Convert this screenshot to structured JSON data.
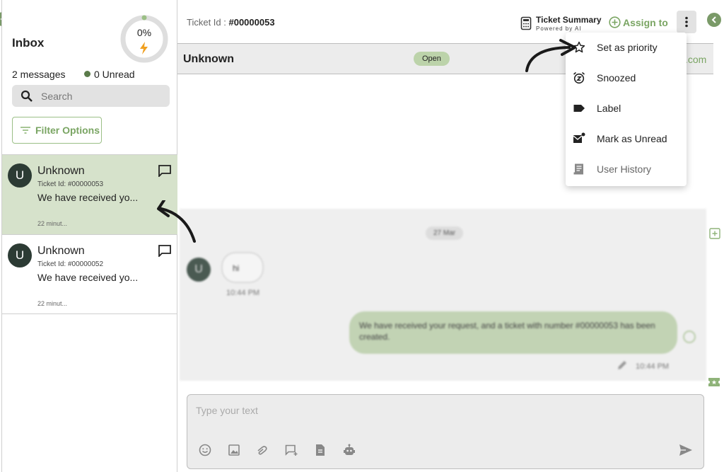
{
  "sidebar": {
    "title": "Inbox",
    "progress_text": "0%",
    "progress_value": 0,
    "message_count": "2 messages",
    "unread": "0 Unread",
    "search_placeholder": "Search",
    "filter_label": "Filter Options",
    "conversations": [
      {
        "initial": "U",
        "name": "Unknown",
        "ticket": "Ticket Id: #00000053",
        "preview": "We have received yo...",
        "time": "22 minut..."
      },
      {
        "initial": "U",
        "name": "Unknown",
        "ticket": "Ticket Id: #00000052",
        "preview": "We have received yo...",
        "time": "22 minut..."
      }
    ]
  },
  "header": {
    "ticket_label": "Ticket Id : ",
    "ticket_value": "#00000053",
    "summary_title": "Ticket Summary",
    "summary_sub": "Powered by AI",
    "assign_label": "Assign to"
  },
  "subheader": {
    "name": "Unknown",
    "status": "Open",
    "right_text": ".com"
  },
  "chat": {
    "date": "27 Mar",
    "incoming": {
      "initial": "U",
      "text": "hi",
      "time": "10:44 PM"
    },
    "outgoing": {
      "text": "We have received your request, and a ticket with number #00000053 has been created.",
      "time": "10:44 PM"
    }
  },
  "composer": {
    "placeholder": "Type your text"
  },
  "menu": {
    "items": [
      {
        "label": "Set as priority",
        "icon": "star-outline-icon"
      },
      {
        "label": "Snoozed",
        "icon": "snooze-alarm-icon"
      },
      {
        "label": "Label",
        "icon": "label-tag-icon"
      },
      {
        "label": "Mark as Unread",
        "icon": "mark-unread-mail-icon"
      },
      {
        "label": "User History",
        "icon": "history-document-icon"
      }
    ]
  },
  "colors": {
    "accent": "#7aa563",
    "active_row": "#d6e2cb",
    "avatar": "#2c3b34",
    "badge": "#bcd3aa"
  }
}
